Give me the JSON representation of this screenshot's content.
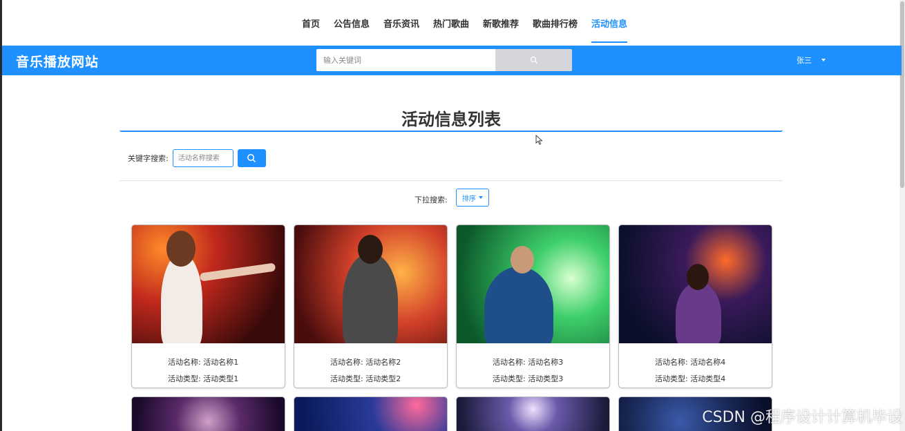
{
  "nav": {
    "items": [
      {
        "label": "首页"
      },
      {
        "label": "公告信息"
      },
      {
        "label": "音乐资讯"
      },
      {
        "label": "热门歌曲"
      },
      {
        "label": "新歌推荐"
      },
      {
        "label": "歌曲排行榜"
      },
      {
        "label": "活动信息"
      }
    ],
    "active": "活动信息"
  },
  "header": {
    "site_title": "音乐播放网站",
    "search_placeholder": "输入关键词",
    "search_icon": "search-icon",
    "user_name": "张三"
  },
  "main": {
    "title": "活动信息列表",
    "keyword_label": "关键字搜索:",
    "keyword_placeholder": "活动名称搜索",
    "dropdown_label": "下拉搜索:",
    "sort_label": "排序"
  },
  "cards": [
    {
      "name_label": "活动名称:",
      "name": "活动名称1",
      "type_label": "活动类型:",
      "type": "活动类型1"
    },
    {
      "name_label": "活动名称:",
      "name": "活动名称2",
      "type_label": "活动类型:",
      "type": "活动类型2"
    },
    {
      "name_label": "活动名称:",
      "name": "活动名称3",
      "type_label": "活动类型:",
      "type": "活动类型3"
    },
    {
      "name_label": "活动名称:",
      "name": "活动名称4",
      "type_label": "活动类型:",
      "type": "活动类型4"
    }
  ],
  "watermark": "CSDN @程序设计计算机毕设",
  "colors": {
    "accent": "#1e90ff",
    "search_button": "#d4d6d9"
  }
}
